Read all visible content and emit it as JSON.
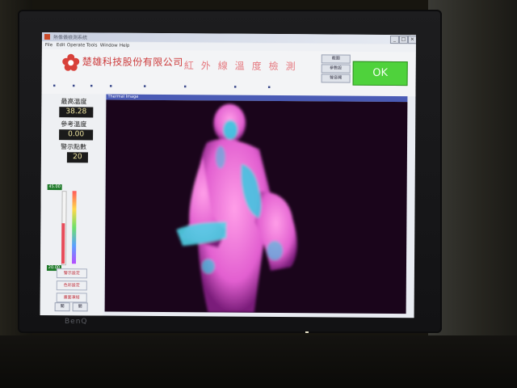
{
  "window": {
    "title": "熱像儀檢測系統",
    "buttons": [
      "_",
      "□",
      "×"
    ]
  },
  "menu": [
    "File",
    "Edit",
    "Operate",
    "Tools",
    "Window",
    "Help"
  ],
  "header": {
    "company": "楚雄科技股份有限公司",
    "banner": "紅外線溫度檢測",
    "side_buttons": [
      "截圖",
      "參數設",
      "聲音開"
    ],
    "ok_label": "OK"
  },
  "panel": {
    "max_temp_label": "最高溫度",
    "max_temp_value": "38.28",
    "offset_label": "參考溫度",
    "offset_value": "0.00",
    "alarm_label": "警示點數",
    "alarm_value": "20",
    "range_high": "45.00",
    "range_low": "20.00",
    "gauge_level": 0.55,
    "buttons": [
      "警示設定",
      "色彩設定",
      "畫面凍結"
    ],
    "small_buttons": [
      "開",
      "關",
      "存",
      "讀",
      "讀取",
      "儲存"
    ]
  },
  "view": {
    "label": "Thermal Image"
  },
  "colors": {
    "ok": "#4fd23c",
    "thermal_bg": "#1a051b",
    "hot": "#f07ad8",
    "cool": "#39c9e0"
  }
}
